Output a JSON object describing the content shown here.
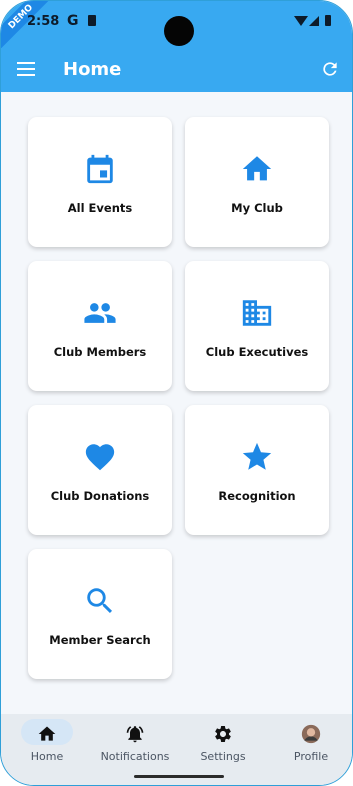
{
  "status_bar": {
    "time": "2:58",
    "g_label": "G",
    "demo_label": "DEMO"
  },
  "app_bar": {
    "title": "Home"
  },
  "tiles": [
    {
      "label": "All Events",
      "icon": "calendar-icon"
    },
    {
      "label": "My Club",
      "icon": "home-icon"
    },
    {
      "label": "Club Members",
      "icon": "people-icon"
    },
    {
      "label": "Club Executives",
      "icon": "building-icon"
    },
    {
      "label": "Club Donations",
      "icon": "heart-icon"
    },
    {
      "label": "Recognition",
      "icon": "star-icon"
    },
    {
      "label": "Member Search",
      "icon": "search-icon"
    }
  ],
  "bottom_nav": [
    {
      "label": "Home",
      "icon": "home-icon",
      "selected": true
    },
    {
      "label": "Notifications",
      "icon": "bell-icon"
    },
    {
      "label": "Settings",
      "icon": "gear-icon"
    },
    {
      "label": "Profile",
      "icon": "avatar-icon"
    }
  ],
  "colors": {
    "primary": "#38a9f1",
    "icon_blue": "#1e88e5",
    "nav_bg": "#e6ebf0"
  }
}
